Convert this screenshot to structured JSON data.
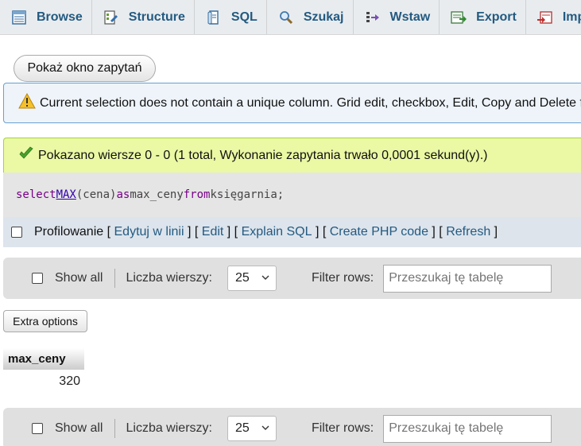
{
  "tabs": [
    {
      "label": "Browse",
      "icon": "browse-icon"
    },
    {
      "label": "Structure",
      "icon": "structure-icon"
    },
    {
      "label": "SQL",
      "icon": "sql-icon"
    },
    {
      "label": "Szukaj",
      "icon": "search-icon"
    },
    {
      "label": "Wstaw",
      "icon": "insert-icon"
    },
    {
      "label": "Export",
      "icon": "export-icon"
    },
    {
      "label": "Import",
      "icon": "import-icon"
    }
  ],
  "query_window_button": "Pokaż okno zapytań",
  "notice": {
    "icon": "warning-icon",
    "text": "Current selection does not contain a unique column. Grid edit, checkbox, Edit, Copy and Delete features are not available."
  },
  "success": {
    "icon": "checkmark-icon",
    "text": "Pokazano wiersze 0 - 0 (1 total, Wykonanie zapytania trwało 0,0001 sekund(y).)"
  },
  "sql": {
    "kw_select": "select",
    "fn_max": "MAX",
    "arg": "(cena)",
    "kw_as": "as",
    "alias": "max_ceny",
    "kw_from": "from",
    "table": "księgarnia;"
  },
  "profiling": {
    "label": "Profilowanie",
    "links": [
      "Edytuj w linii",
      "Edit",
      "Explain SQL",
      "Create PHP code",
      "Refresh"
    ]
  },
  "nav": {
    "show_all": "Show all",
    "rows_label": "Liczba wierszy:",
    "rows_value": "25",
    "filter_label": "Filter rows:",
    "filter_placeholder": "Przeszukaj tę tabelę"
  },
  "extra_options": "Extra options",
  "table": {
    "header": "max_ceny",
    "value": "320"
  },
  "colors": {
    "link": "#235a81",
    "success_bg": "#ebf8a4",
    "notice_bg": "#eef4fa",
    "notice_border": "#6aa0cf"
  }
}
